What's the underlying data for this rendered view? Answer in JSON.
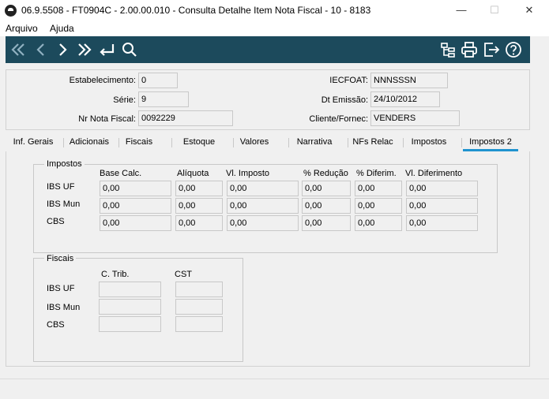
{
  "window": {
    "title": "06.9.5508 - FT0904C - 2.00.00.010 - Consulta Detalhe Item Nota Fiscal - 10 - 8183",
    "minimize": "—",
    "maximize": "☐",
    "close": "✕"
  },
  "menu": {
    "file": "Arquivo",
    "help": "Ajuda"
  },
  "toolbar": {
    "icons": [
      "first-icon",
      "previous-icon",
      "next-icon",
      "last-icon",
      "goto-icon",
      "search-icon",
      "hierarchy-icon",
      "print-icon",
      "exit-icon",
      "help-icon"
    ],
    "color": "#1c4a5c"
  },
  "header": {
    "estabelecimento_label": "Estabelecimento:",
    "estabelecimento_value": "0",
    "serie_label": "Série:",
    "serie_value": "9",
    "nr_nota_label": "Nr Nota Fiscal:",
    "nr_nota_value": "0092229",
    "iecfoat_label": "IECFOAT:",
    "iecfoat_value": "NNNSSSN",
    "dt_emissao_label": "Dt Emissão:",
    "dt_emissao_value": "24/10/2012",
    "cliente_label": "Cliente/Fornec:",
    "cliente_value": "VENDERS"
  },
  "tabs": [
    "Inf. Gerais",
    "Adicionais",
    "Fiscais",
    "Estoque",
    "Valores",
    "Narrativa",
    "NFs Relac",
    "Impostos",
    "Impostos 2"
  ],
  "active_tab": "Impostos 2",
  "accent_color": "#1f93cf",
  "impostos": {
    "title": "Impostos",
    "columns": [
      "Base Calc.",
      "Alíquota",
      "Vl. Imposto",
      "% Redução",
      "% Diferim.",
      "Vl. Diferimento"
    ],
    "rows": [
      {
        "label": "IBS UF",
        "values": [
          "0,00",
          "0,00",
          "0,00",
          "0,00",
          "0,00",
          "0,00"
        ]
      },
      {
        "label": "IBS Mun",
        "values": [
          "0,00",
          "0,00",
          "0,00",
          "0,00",
          "0,00",
          "0,00"
        ]
      },
      {
        "label": "CBS",
        "values": [
          "0,00",
          "0,00",
          "0,00",
          "0,00",
          "0,00",
          "0,00"
        ]
      }
    ]
  },
  "fiscais": {
    "title": "Fiscais",
    "columns": [
      "C. Trib.",
      "CST"
    ],
    "rows": [
      {
        "label": "IBS UF",
        "values": [
          "",
          ""
        ]
      },
      {
        "label": "IBS Mun",
        "values": [
          "",
          ""
        ]
      },
      {
        "label": "CBS",
        "values": [
          "",
          ""
        ]
      }
    ]
  }
}
